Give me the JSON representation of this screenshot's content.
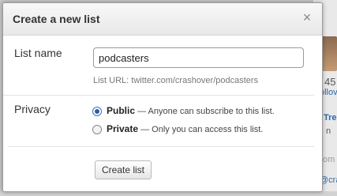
{
  "dialog": {
    "title": "Create a new list",
    "close_glyph": "×"
  },
  "list_name": {
    "label": "List name",
    "value": "podcasters",
    "url_text": "List URL: twitter.com/crashover/podcasters"
  },
  "privacy": {
    "label": "Privacy",
    "options": [
      {
        "title": "Public",
        "description": " — Anyone can subscribe to this list.",
        "selected": true
      },
      {
        "title": "Private",
        "description": " — Only you can access this list.",
        "selected": false
      }
    ]
  },
  "submit": {
    "label": "Create list"
  },
  "background": {
    "fragments": [
      "45",
      "ollov",
      "Tre",
      "n",
      "om",
      "@cra"
    ]
  },
  "colors": {
    "link": "#2a6aa5",
    "accent_radio": "#2a5fa7"
  }
}
